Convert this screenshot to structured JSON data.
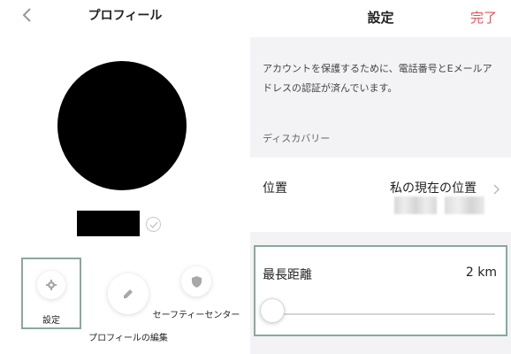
{
  "profile": {
    "title": "プロフィール",
    "actions": {
      "settings_label": "設定",
      "edit_label": "プロフィールの編集",
      "safety_label": "セーフティーセンター"
    }
  },
  "settings": {
    "title": "設定",
    "done_label": "完了",
    "info_text": "アカウントを保護するために、電話番号とEメールアドレスの認証が済んでいます。",
    "discovery_label": "ディスカバリー",
    "location": {
      "label": "位置",
      "value": "私の現在の位置"
    },
    "max_distance": {
      "label": "最長距離",
      "value": "2 km",
      "slider_fraction": 0.0
    }
  },
  "colors": {
    "accent": "#e8505b",
    "highlight_border": "#8aa89c",
    "icon_gray": "#a8a8a8"
  },
  "icons": [
    "chevron-left-icon",
    "check-icon",
    "gear-icon",
    "pencil-icon",
    "shield-icon",
    "chevron-right-icon"
  ]
}
